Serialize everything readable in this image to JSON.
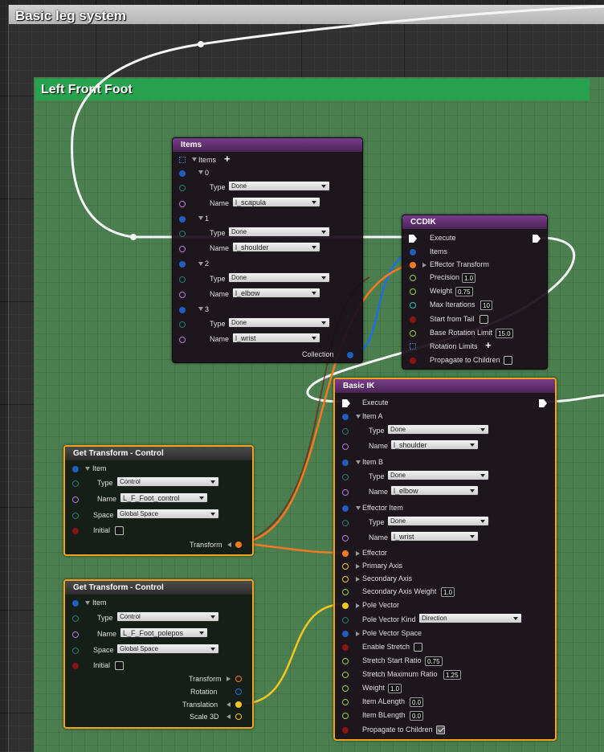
{
  "outer_comment": {
    "title": "Basic leg system"
  },
  "green_comment": {
    "title": "Left Front Foot"
  },
  "colors": {
    "struct_pin": "#1f5fbf",
    "name_pin": "#b27bd6",
    "type_pin": "#1e7e6e",
    "bool_pin": "#8a1414",
    "float_pin": "#8fd43f",
    "transform_pin": "#f47a1f",
    "vector_pin": "#f2c81e",
    "int_pin": "#2cc4b4",
    "exec_pin": "#ffffff",
    "selected_border": "#f3a31b"
  },
  "items_node": {
    "title": "Items",
    "array_label": "Items",
    "add_icon": "plus-icon",
    "entries": [
      {
        "index": "0",
        "type_label": "Type",
        "type_value": "Done",
        "name_label": "Name",
        "name_value": "l_scapula"
      },
      {
        "index": "1",
        "type_label": "Type",
        "type_value": "Done",
        "name_label": "Name",
        "name_value": "l_shoulder"
      },
      {
        "index": "2",
        "type_label": "Type",
        "type_value": "Done",
        "name_label": "Name",
        "name_value": "l_elbow"
      },
      {
        "index": "3",
        "type_label": "Type",
        "type_value": "Done",
        "name_label": "Name",
        "name_value": "l_wrist"
      }
    ],
    "output_label": "Collection"
  },
  "ccdik_node": {
    "title": "CCDIK",
    "execute": "Execute",
    "items": "Items",
    "effector_transform": "Effector Transform",
    "precision_label": "Precision",
    "precision_value": "1.0",
    "weight_label": "Weight",
    "weight_value": "0.75",
    "max_iterations_label": "Max Iterations",
    "max_iterations_value": "10",
    "start_from_tail_label": "Start from Tail",
    "base_rotation_limit_label": "Base Rotation Limit",
    "base_rotation_limit_value": "15.0",
    "rotation_limits_label": "Rotation Limits",
    "propagate_label": "Propagate to Children"
  },
  "basic_ik_node": {
    "title": "Basic IK",
    "execute": "Execute",
    "item_a": {
      "label": "Item A",
      "type_label": "Type",
      "type_value": "Done",
      "name_label": "Name",
      "name_value": "l_shoulder"
    },
    "item_b": {
      "label": "Item B",
      "type_label": "Type",
      "type_value": "Done",
      "name_label": "Name",
      "name_value": "l_elbow"
    },
    "effector_item": {
      "label": "Effector Item",
      "type_label": "Type",
      "type_value": "Done",
      "name_label": "Name",
      "name_value": "l_wrist"
    },
    "effector": "Effector",
    "primary_axis": "Primary Axis",
    "secondary_axis": "Secondary Axis",
    "secondary_axis_weight_label": "Secondary Axis Weight",
    "secondary_axis_weight_value": "1.0",
    "pole_vector": "Pole Vector",
    "pole_vector_kind_label": "Pole Vector Kind",
    "pole_vector_kind_value": "Direction",
    "pole_vector_space": "Pole Vector Space",
    "enable_stretch_label": "Enable Stretch",
    "stretch_start_ratio_label": "Stretch Start Ratio",
    "stretch_start_ratio_value": "0.75",
    "stretch_max_ratio_label": "Stretch Maximum Ratio",
    "stretch_max_ratio_value": "1.25",
    "weight_label": "Weight",
    "weight_value": "1.0",
    "item_a_length_label": "Item ALength",
    "item_a_length_value": "0.0",
    "item_b_length_label": "Item BLength",
    "item_b_length_value": "0.0",
    "propagate_label": "Propagate to Children"
  },
  "get_transform_1": {
    "title": "Get Transform - Control",
    "item": "Item",
    "type_label": "Type",
    "type_value": "Control",
    "name_label": "Name",
    "name_value": "L_F_Foot_control",
    "space_label": "Space",
    "space_value": "Global Space",
    "initial_label": "Initial",
    "transform_out": "Transform"
  },
  "get_transform_2": {
    "title": "Get Transform - Control",
    "item": "Item",
    "type_label": "Type",
    "type_value": "Control",
    "name_label": "Name",
    "name_value": "L_F_Foot_polepos",
    "space_label": "Space",
    "space_value": "Global Space",
    "initial_label": "Initial",
    "transform_out": "Transform",
    "rotation_out": "Rotation",
    "translation_out": "Translation",
    "scale_out": "Scale 3D"
  }
}
